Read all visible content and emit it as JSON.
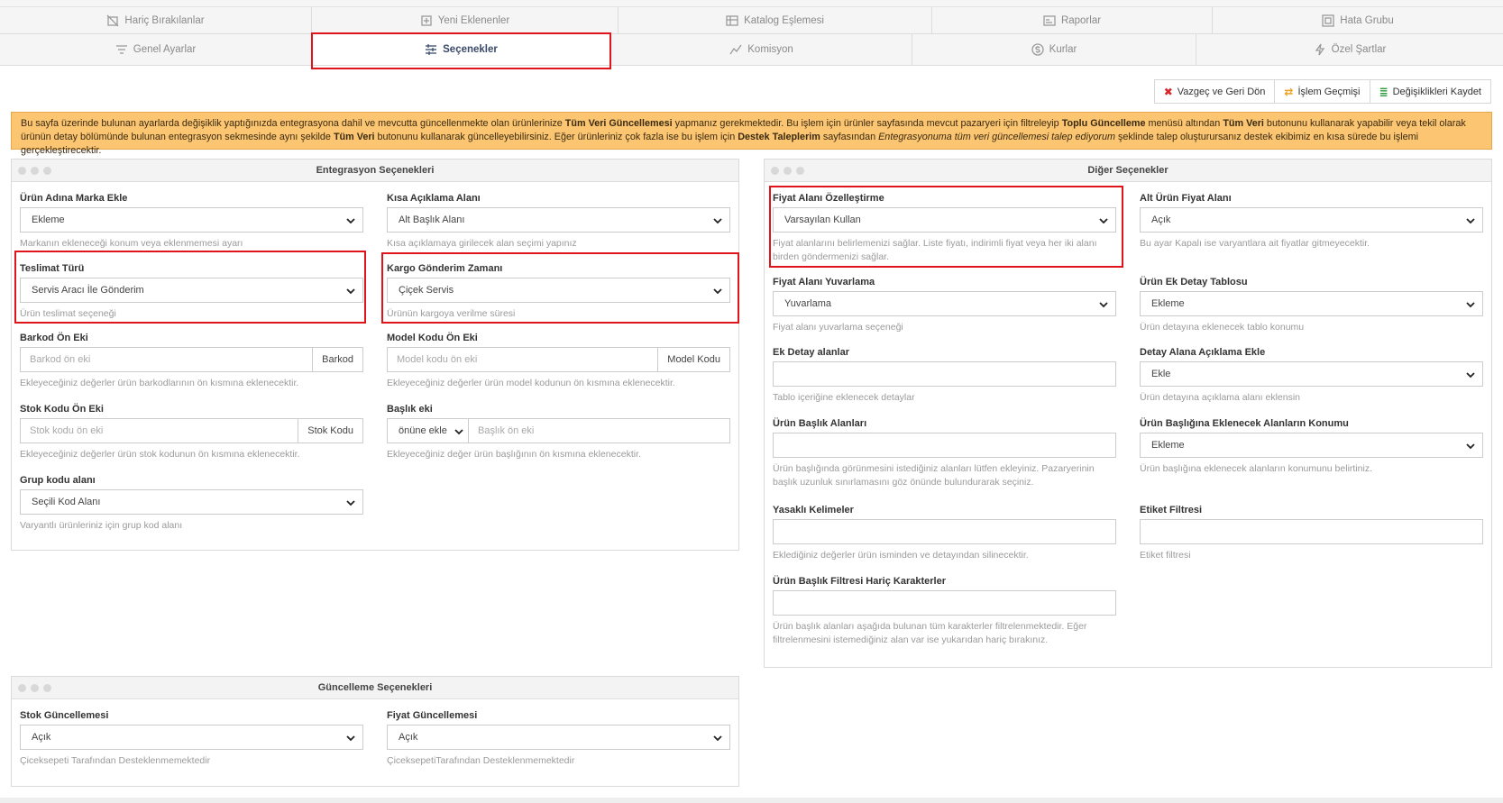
{
  "tabs_row1": [
    {
      "label": "Hariç Bırakılanlar",
      "icon": "exclude-icon"
    },
    {
      "label": "Yeni Eklenenler",
      "icon": "new-items-icon"
    },
    {
      "label": "Katalog Eşlemesi",
      "icon": "catalog-icon"
    },
    {
      "label": "Raporlar",
      "icon": "report-icon"
    },
    {
      "label": "Hata Grubu",
      "icon": "error-group-icon"
    }
  ],
  "tabs_row2": [
    {
      "label": "Genel Ayarlar",
      "icon": "general-settings-icon"
    },
    {
      "label": "Seçenekler",
      "icon": "options-icon",
      "active": true
    },
    {
      "label": "Komisyon",
      "icon": "commission-icon"
    },
    {
      "label": "Kurlar",
      "icon": "currency-icon"
    },
    {
      "label": "Özel Şartlar",
      "icon": "bolt-icon"
    }
  ],
  "actions": {
    "cancel": "Vazgeç ve Geri Dön",
    "history": "İşlem Geçmişi",
    "save": "Değişiklikleri Kaydet"
  },
  "warning": {
    "p1": "Bu sayfa üzerinde bulunan ayarlarda değişiklik yaptığınızda entegrasyona dahil ve mevcutta güncellenmekte olan ürünlerinize ",
    "b1": "Tüm Veri Güncellemesi",
    "p2": " yapmanız gerekmektedir. Bu işlem için ürünler sayfasında mevcut pazaryeri için filtreleyip ",
    "b2": "Toplu Güncelleme",
    "p3": " menüsü altından ",
    "b3": "Tüm Veri",
    "p4": " butonunu kullanarak yapabilir veya tekil olarak ürünün detay bölümünde bulunan entegrasyon sekmesinde aynı şekilde ",
    "b4": "Tüm Veri",
    "p5": " butonunu kullanarak güncelleyebilirsiniz. Eğer ürünleriniz çok fazla ise bu işlem için ",
    "b5": "Destek Taleplerim",
    "p6": " sayfasından ",
    "i1": "Entegrasyonuma tüm veri güncellemesi talep ediyorum",
    "p7": " şeklinde talep oluşturursanız destek ekibimiz en kısa sürede bu işlemi gerçekleştirecektir."
  },
  "integration": {
    "title": "Entegrasyon Seçenekleri",
    "brand": {
      "label": "Ürün Adına Marka Ekle",
      "value": "Ekleme",
      "hint": "Markanın ekleneceği konum veya eklenmemesi ayarı"
    },
    "short_desc": {
      "label": "Kısa Açıklama Alanı",
      "value": "Alt Başlık Alanı",
      "hint": "Kısa açıklamaya girilecek alan seçimi yapınız"
    },
    "delivery": {
      "label": "Teslimat Türü",
      "value": "Servis Aracı İle Gönderim",
      "hint": "Ürün teslimat seçeneği"
    },
    "cargo_time": {
      "label": "Kargo Gönderim Zamanı",
      "value": "Çiçek Servis",
      "hint": "Ürünün kargoya verilme süresi"
    },
    "barcode_prefix": {
      "label": "Barkod Ön Eki",
      "placeholder": "Barkod ön eki",
      "addon": "Barkod",
      "hint": "Ekleyeceğiniz değerler ürün barkodlarının ön kısmına eklenecektir."
    },
    "model_prefix": {
      "label": "Model Kodu Ön Eki",
      "placeholder": "Model kodu ön eki",
      "addon": "Model Kodu",
      "hint": "Ekleyeceğiniz değerler ürün model kodunun ön kısmına eklenecektir."
    },
    "stock_prefix": {
      "label": "Stok Kodu Ön Eki",
      "placeholder": "Stok kodu ön eki",
      "addon": "Stok Kodu",
      "hint": "Ekleyeceğiniz değerler ürün stok kodunun ön kısmına eklenecektir."
    },
    "title_prefix": {
      "label": "Başlık eki",
      "select": "önüne ekle",
      "placeholder": "Başlık ön eki",
      "hint": "Ekleyeceğiniz değer ürün başlığının ön kısmına eklenecektir."
    },
    "group_code": {
      "label": "Grup kodu alanı",
      "value": "Seçili Kod Alanı",
      "hint": "Varyantlı ürünleriniz için grup kod alanı"
    }
  },
  "other": {
    "title": "Diğer Seçenekler",
    "price_custom": {
      "label": "Fiyat Alanı Özelleştirme",
      "value": "Varsayılan Kullan",
      "hint": "Fiyat alanlarını belirlemenizi sağlar. Liste fiyatı, indirimli fiyat veya her iki alanı birden göndermenizi sağlar."
    },
    "sub_price": {
      "label": "Alt Ürün Fiyat Alanı",
      "value": "Açık",
      "hint": "Bu ayar Kapalı ise varyantlara ait fiyatlar gitmeyecektir."
    },
    "price_round": {
      "label": "Fiyat Alanı Yuvarlama",
      "value": "Yuvarlama",
      "hint": "Fiyat alanı yuvarlama seçeneği"
    },
    "extra_table": {
      "label": "Ürün Ek Detay Tablosu",
      "value": "Ekleme",
      "hint": "Ürün detayına eklenecek tablo konumu"
    },
    "extra_fields": {
      "label": "Ek Detay alanlar",
      "hint": "Tablo içeriğine eklenecek detaylar"
    },
    "detail_desc": {
      "label": "Detay Alana Açıklama Ekle",
      "value": "Ekle",
      "hint": "Ürün detayına açıklama alanı eklensin"
    },
    "title_fields": {
      "label": "Ürün Başlık Alanları",
      "hint": "Ürün başlığında görünmesini istediğiniz alanları lütfen ekleyiniz. Pazaryerinin başlık uzunluk sınırlamasını göz önünde bulundurarak seçiniz."
    },
    "title_pos": {
      "label": "Ürün Başlığına Eklenecek Alanların Konumu",
      "value": "Ekleme",
      "hint": "Ürün başlığına eklenecek alanların konumunu belirtiniz."
    },
    "banned": {
      "label": "Yasaklı Kelimeler",
      "hint": "Eklediğiniz değerler ürün isminden ve detayından silinecektir."
    },
    "tag_filter": {
      "label": "Etiket Filtresi",
      "hint": "Etiket filtresi"
    },
    "title_filter": {
      "label": "Ürün Başlık Filtresi Hariç Karakterler",
      "hint": "Ürün başlık alanları aşağıda bulunan tüm karakterler filtrelenmektedir. Eğer filtrelenmesini istemediğiniz alan var ise yukarıdan hariç bırakınız."
    }
  },
  "update": {
    "title": "Güncelleme Seçenekleri",
    "stock": {
      "label": "Stok Güncellemesi",
      "value": "Açık",
      "hint": "Çiceksepeti Tarafından Desteklenmemektedir"
    },
    "price": {
      "label": "Fiyat Güncellemesi",
      "value": "Açık",
      "hint": "ÇiceksepetiTarafından Desteklenmemektedir"
    }
  }
}
